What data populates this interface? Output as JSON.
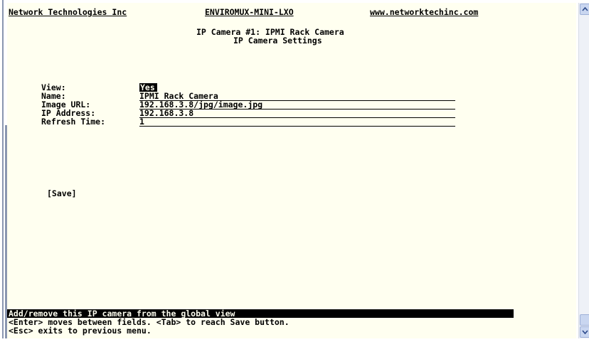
{
  "header": {
    "company": "Network Technologies Inc",
    "product": "ENVIROMUX-MINI-LXO",
    "website": "www.networktechinc.com"
  },
  "page": {
    "title": "IP Camera #1: IPMI Rack Camera",
    "subtitle": "IP Camera Settings"
  },
  "form": {
    "view_label": "View:",
    "view_value": "Yes",
    "name_label": "Name:",
    "name_value": "IPMI Rack Camera",
    "url_label": "Image URL:",
    "url_value": "192.168.3.8/jpg/image.jpg",
    "ip_label": "IP Address:",
    "ip_value": "192.168.3.8",
    "refresh_label": "Refresh Time:",
    "refresh_value": "1"
  },
  "save_label": "[Save]",
  "footer": {
    "status": "Add/remove this IP camera from the global view",
    "help1": "<Enter> moves between fields. <Tab> to reach Save button.",
    "help2": "<Esc> exits to previous menu."
  },
  "icons": {
    "scroll_up": "chevron-up-icon",
    "scroll_down": "chevron-down-icon"
  }
}
